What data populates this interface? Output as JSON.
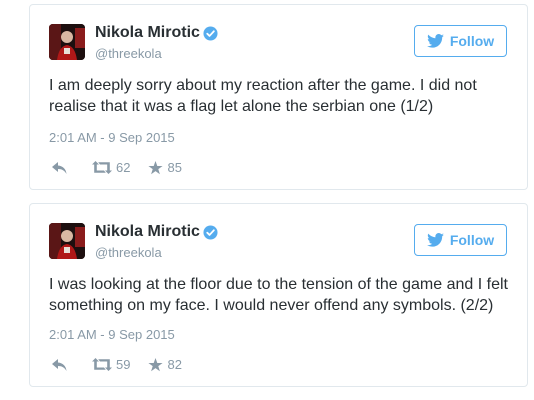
{
  "tweets": [
    {
      "name": "Nikola Mirotic",
      "handle": "@threekola",
      "follow_label": "Follow",
      "text": "I am deeply sorry about my reaction after the game. I did not realise that it was a flag let alone the serbian one (1/2)",
      "timestamp": "2:01 AM - 9 Sep 2015",
      "retweets": "62",
      "likes": "85"
    },
    {
      "name": "Nikola Mirotic",
      "handle": "@threekola",
      "follow_label": "Follow",
      "text": "I was looking at the floor due to the tension of the game and I felt something on my face. I would never offend any symbols. (2/2)",
      "timestamp": "2:01 AM - 9 Sep 2015",
      "retweets": "59",
      "likes": "82"
    }
  ],
  "icons": {
    "verified": "verified-badge-icon",
    "follow": "twitter-bird-icon",
    "reply": "reply-icon",
    "retweet": "retweet-icon",
    "like": "star-icon"
  },
  "colors": {
    "twitter_blue": "#55acee",
    "secondary_text": "#8899a6",
    "border": "#e1e8ed"
  }
}
